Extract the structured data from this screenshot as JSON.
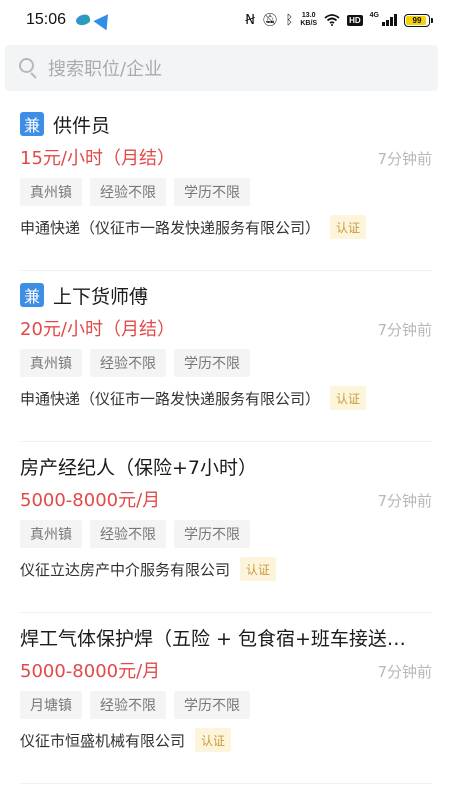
{
  "status_bar": {
    "time": "15:06",
    "net_speed_value": "13.0",
    "net_speed_unit": "KB/S",
    "hd_badge": "HD",
    "signal_label": "4G",
    "battery_level": "99",
    "icons": [
      "nfc-icon",
      "mute-icon",
      "bluetooth-icon",
      "wifi-icon",
      "hd-icon",
      "signal-icon",
      "battery-icon"
    ]
  },
  "search": {
    "placeholder": "搜索职位/企业"
  },
  "colors": {
    "salary": "#e14a48",
    "part_time_tag": "#3f8ee6",
    "verified_bg": "#fdf4dc",
    "verified_text": "#c99a3b"
  },
  "jobs": [
    {
      "tag": "兼",
      "title": "供件员",
      "salary": "15元/小时（月结）",
      "posted": "7分钟前",
      "chips": [
        "真州镇",
        "经验不限",
        "学历不限"
      ],
      "company": "申通快递（仪征市一路发快递服务有限公司）",
      "verified": "认证"
    },
    {
      "tag": "兼",
      "title": "上下货师傅",
      "salary": "20元/小时（月结）",
      "posted": "7分钟前",
      "chips": [
        "真州镇",
        "经验不限",
        "学历不限"
      ],
      "company": "申通快递（仪征市一路发快递服务有限公司）",
      "verified": "认证"
    },
    {
      "title": "房产经纪人（保险+7小时）",
      "salary": "5000-8000元/月",
      "posted": "7分钟前",
      "chips": [
        "真州镇",
        "经验不限",
        "学历不限"
      ],
      "company": "仪征立达房产中介服务有限公司",
      "verified": "认证"
    },
    {
      "title": "焊工气体保护焊（五险 + 包食宿+班车接送…",
      "salary": "5000-8000元/月",
      "posted": "7分钟前",
      "chips": [
        "月塘镇",
        "经验不限",
        "学历不限"
      ],
      "company": "仪征市恒盛机械有限公司",
      "verified": "认证"
    }
  ]
}
